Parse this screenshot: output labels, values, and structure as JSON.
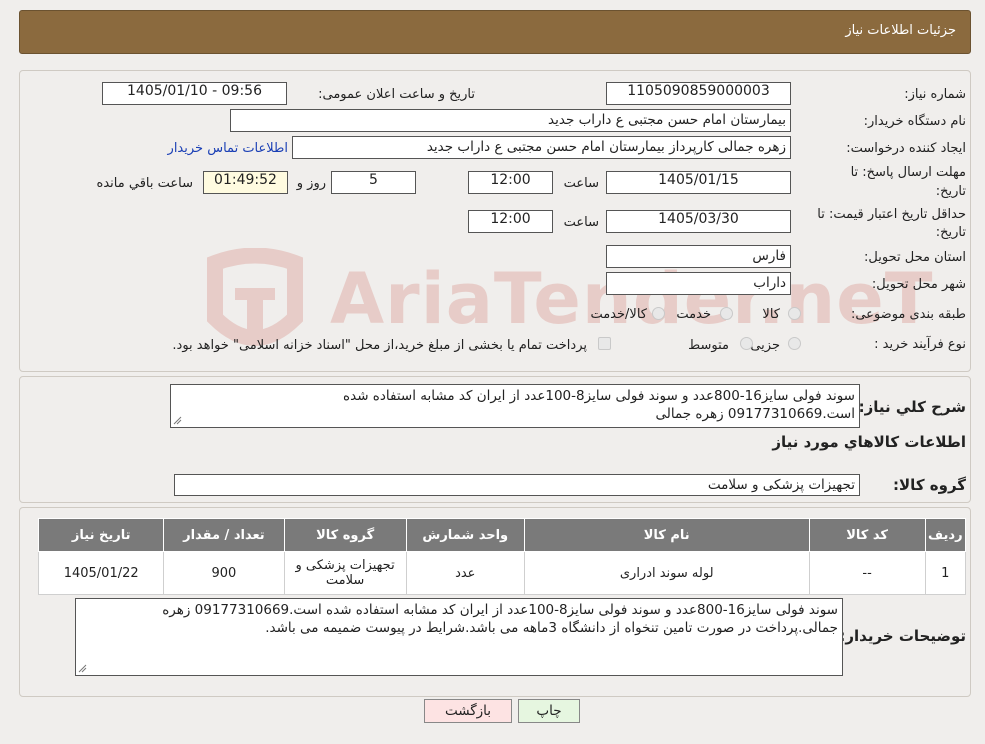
{
  "header": {
    "title": "جزئیات اطلاعات نیاز"
  },
  "form": {
    "need_number_label": "شماره نیاز:",
    "need_number": "1105090859000003",
    "announce_label": "تاریخ و ساعت اعلان عمومی:",
    "announce_value": "1405/01/10 - 09:56",
    "buyer_org_label": "نام دستگاه خریدار:",
    "buyer_org": "بیمارستان امام حسن مجتبی  ع  داراب جدید",
    "creator_label": "ایجاد کننده درخواست:",
    "creator": "زهره جمالی کارپرداز بیمارستان امام حسن مجتبی  ع  داراب جدید",
    "contact_link": "اطلاعات تماس خریدار",
    "deadline_label_1": "مهلت ارسال پاسخ: تا",
    "deadline_label_2": "تاریخ:",
    "deadline_date": "1405/01/15",
    "time_word": "ساعت",
    "deadline_time": "12:00",
    "days_value": "5",
    "days_word": "روز و",
    "remaining_time": "01:49:52",
    "remaining_text": "ساعت باقي مانده",
    "validity_label_1": "حداقل تاریخ اعتبار قیمت: تا",
    "validity_label_2": "تاریخ:",
    "validity_date": "1405/03/30",
    "validity_time": "12:00",
    "province_label": "استان محل تحویل:",
    "province": "فارس",
    "city_label": "شهر محل تحویل:",
    "city": "داراب",
    "category_label": "طبقه بندی موضوعی:",
    "category_options": [
      "کالا",
      "خدمت",
      "کالا/خدمت"
    ],
    "process_label": "نوع فرآیند خرید :",
    "process_options": [
      "جزیی",
      "متوسط"
    ],
    "process_note": "پرداخت تمام یا بخشی از مبلغ خرید،از محل \"اسناد خزانه اسلامی\" خواهد بود."
  },
  "summary": {
    "label": "شرح کلي نياز:",
    "text_line1": "سوند فولی سایز16-800عدد و سوند فولی سایز8-100عدد از ایران کد مشابه استفاده شده",
    "text_line2": "است.09177310669 زهره جمالی",
    "goods_info_title": "اطلاعات کالاهاي مورد نياز",
    "goods_group_label": "گروه کالا:",
    "goods_group": "تجهیزات پزشکی و سلامت"
  },
  "table": {
    "headers": [
      "ردیف",
      "کد کالا",
      "نام کالا",
      "واحد شمارش",
      "گروه کالا",
      "تعداد / مقدار",
      "تاریخ نیاز"
    ],
    "rows": [
      {
        "index": "1",
        "code": "--",
        "name": "لوله سوند ادراری",
        "unit": "عدد",
        "group_line1": "تجهیزات پزشکی و",
        "group_line2": "سلامت",
        "qty": "900",
        "date": "1405/01/22"
      }
    ]
  },
  "buyer_notes": {
    "label": "توضیحات خریدار:",
    "line1": "سوند فولی سایز16-800عدد و سوند فولی سایز8-100عدد از ایران کد مشابه استفاده شده است.09177310669 زهره",
    "line2": "جمالی.پرداخت در صورت تامین تنخواه از دانشگاه 3ماهه می باشد.شرایط در پیوست ضمیمه می باشد."
  },
  "buttons": {
    "print": "چاپ",
    "back": "بازگشت"
  },
  "watermark": {
    "text": "AriaTender.neT"
  },
  "colors": {
    "header_bg": "#8b6a3e",
    "link": "#1a3fb5",
    "back_button_bg": "#fde3e3",
    "print_button_bg": "#e6f6e0",
    "table_header_bg": "#7a7a7a",
    "watermark": "#c0392b"
  }
}
